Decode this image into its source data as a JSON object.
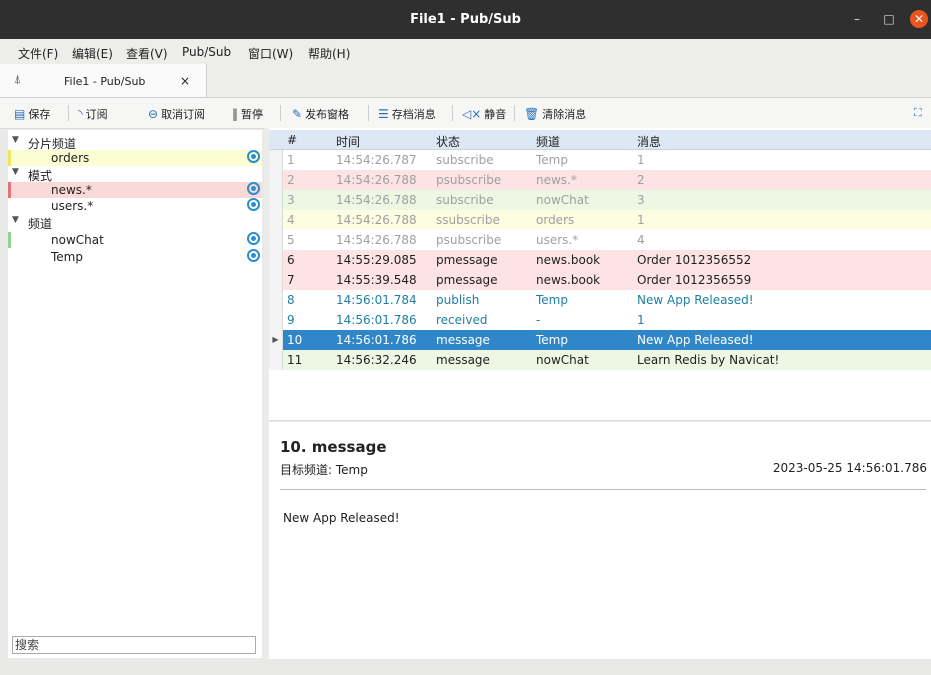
{
  "window": {
    "title": "File1 - Pub/Sub"
  },
  "menu": [
    "文件(F)",
    "编辑(E)",
    "查看(V)",
    "Pub/Sub",
    "窗口(W)",
    "帮助(H)"
  ],
  "tab": {
    "label": "File1 - Pub/Sub",
    "close": "×"
  },
  "toolbar": {
    "save": "保存",
    "subscribe": "订阅",
    "unsubscribe": "取消订阅",
    "pause": "暂停",
    "publish_pane": "发布窗格",
    "archive": "存档消息",
    "mute": "静音",
    "clear": "清除消息"
  },
  "tree": [
    {
      "type": "group",
      "label": "分片频道"
    },
    {
      "type": "item",
      "label": "orders",
      "color": "#fdfdd4",
      "bar": "#e8e85a",
      "eye": true
    },
    {
      "type": "group",
      "label": "模式"
    },
    {
      "type": "item",
      "label": "news.*",
      "color": "#fcd9d9",
      "bar": "#e57373",
      "eye": true
    },
    {
      "type": "item",
      "label": "users.*",
      "color": "#ffffff",
      "bar": "",
      "eye": true
    },
    {
      "type": "group",
      "label": "频道"
    },
    {
      "type": "item",
      "label": "nowChat",
      "color": "#ffffff",
      "bar": "#8fd48f",
      "eye": true
    },
    {
      "type": "item",
      "label": "Temp",
      "color": "#ffffff",
      "bar": "",
      "eye": true
    }
  ],
  "search": {
    "placeholder": "搜索"
  },
  "table": {
    "headers": [
      "#",
      "时间",
      "状态",
      "频道",
      "消息"
    ],
    "rows": [
      {
        "cells": [
          "1",
          "14:54:26.787",
          "subscribe",
          "Temp",
          "1"
        ],
        "bg": "#ffffff",
        "fg": "#a0a0a0"
      },
      {
        "cells": [
          "2",
          "14:54:26.788",
          "psubscribe",
          "news.*",
          "2"
        ],
        "bg": "#fde3e3",
        "fg": "#a0a0a0"
      },
      {
        "cells": [
          "3",
          "14:54:26.788",
          "subscribe",
          "nowChat",
          "3"
        ],
        "bg": "#ecf8e4",
        "fg": "#a0a0a0"
      },
      {
        "cells": [
          "4",
          "14:54:26.788",
          "ssubscribe",
          "orders",
          "1"
        ],
        "bg": "#fdfde2",
        "fg": "#a0a0a0"
      },
      {
        "cells": [
          "5",
          "14:54:26.788",
          "psubscribe",
          "users.*",
          "4"
        ],
        "bg": "#ffffff",
        "fg": "#a0a0a0"
      },
      {
        "cells": [
          "6",
          "14:55:29.085",
          "pmessage",
          "news.book",
          "Order 1012356552"
        ],
        "bg": "#fde3e3",
        "fg": "#222222"
      },
      {
        "cells": [
          "7",
          "14:55:39.548",
          "pmessage",
          "news.book",
          "Order 1012356559"
        ],
        "bg": "#fde3e3",
        "fg": "#222222"
      },
      {
        "cells": [
          "8",
          "14:56:01.784",
          "publish",
          "Temp",
          "New App Released!"
        ],
        "bg": "#ffffff",
        "fg": "#1e7fa0"
      },
      {
        "cells": [
          "9",
          "14:56:01.786",
          "received",
          "-",
          "1"
        ],
        "bg": "#ffffff",
        "fg": "#1e7fa0"
      },
      {
        "cells": [
          "10",
          "14:56:01.786",
          "message",
          "Temp",
          "New App Released!"
        ],
        "bg": "#2f86c8",
        "fg": "#ffffff",
        "selected": true
      },
      {
        "cells": [
          "11",
          "14:56:32.246",
          "message",
          "nowChat",
          "Learn Redis by Navicat!"
        ],
        "bg": "#ecf8e4",
        "fg": "#222222"
      }
    ]
  },
  "detail": {
    "title": "10. message",
    "channel": "目标频道: Temp",
    "time": "2023-05-25 14:56:01.786",
    "message": "New App Released!"
  },
  "colors": {
    "accent": "#2f86c8",
    "titlebar": "#2f2f2f",
    "close": "#e95420"
  }
}
